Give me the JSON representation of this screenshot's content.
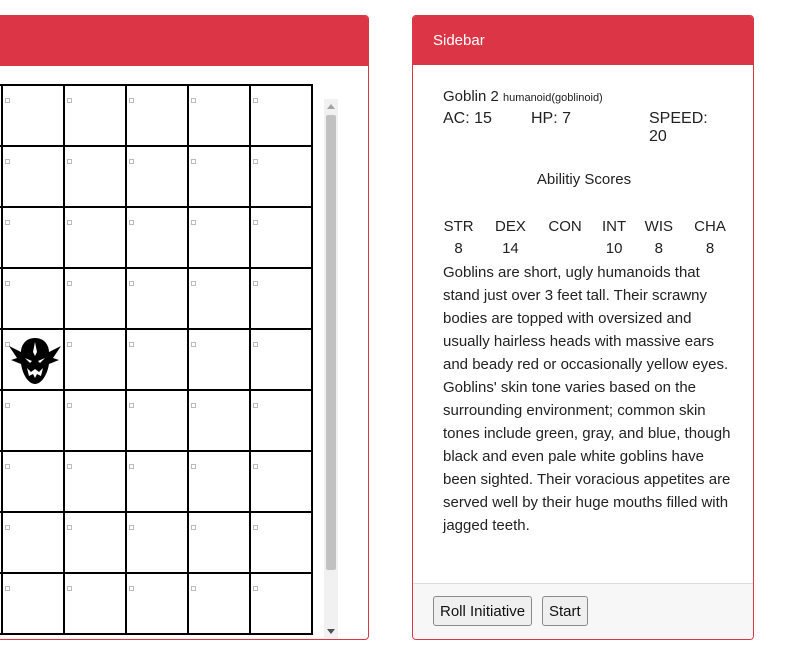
{
  "map": {
    "rows": 9,
    "cols": 6,
    "token": {
      "row": 4,
      "col": 1,
      "icon": "goblin-icon"
    }
  },
  "sidebar": {
    "title": "Sidebar",
    "monster": {
      "name": "Goblin 2",
      "type": "humanoid(goblinoid)",
      "ac": "AC: 15",
      "hp": "HP: 7",
      "speed": "SPEED: 20"
    },
    "ability_title": "Abilitiy Scores",
    "abilities": [
      {
        "label": "STR",
        "value": "8"
      },
      {
        "label": "DEX",
        "value": "14"
      },
      {
        "label": "CON",
        "value": ""
      },
      {
        "label": "INT",
        "value": "10"
      },
      {
        "label": "WIS",
        "value": "8"
      },
      {
        "label": "CHA",
        "value": "8"
      }
    ],
    "description": "Goblins are short, ugly humanoids that stand just over 3 feet tall. Their scrawny bodies are topped with oversized and usually hairless heads with massive ears and beady red or occasionally yellow eyes. Goblins' skin tone varies based on the surrounding environment; common skin tones include green, gray, and blue, though black and even pale white goblins have been sighted. Their voracious appetites are served well by their huge mouths filled with jagged teeth.",
    "buttons": {
      "roll_initiative": "Roll Initiative",
      "start": "Start"
    }
  },
  "colors": {
    "accent": "#dc3545"
  }
}
